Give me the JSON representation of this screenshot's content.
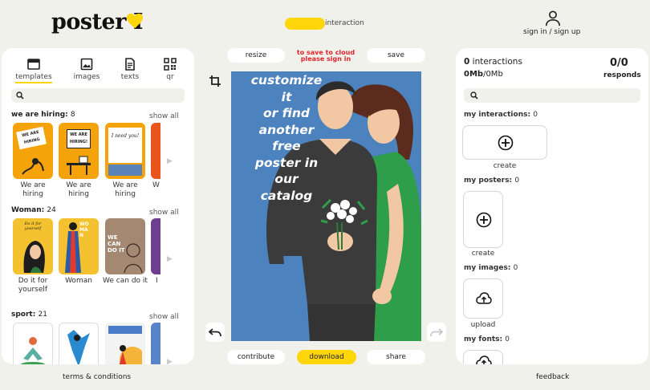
{
  "header": {
    "logo_text": "poster I",
    "interaction_label": "interaction",
    "signin_label": "sign in / sign up",
    "accent_color": "#ffd60a"
  },
  "left_panel": {
    "tabs": [
      {
        "label": "templates",
        "icon": "templates-icon",
        "active": true
      },
      {
        "label": "images",
        "icon": "image-icon",
        "active": false
      },
      {
        "label": "texts",
        "icon": "document-icon",
        "active": false
      },
      {
        "label": "qr",
        "icon": "qr-code-icon",
        "active": false
      }
    ],
    "show_all_label": "show all",
    "sections": [
      {
        "title": "we are hiring:",
        "count": "8",
        "items": [
          {
            "caption": "We are hiring",
            "thumb_text": "WE ARE HIRING"
          },
          {
            "caption": "We are hiring",
            "thumb_text": "WE ARE HIRING!"
          },
          {
            "caption": "We are hiring",
            "thumb_text": "I need you!"
          },
          {
            "caption": "W"
          }
        ]
      },
      {
        "title": "Woman:",
        "count": "24",
        "items": [
          {
            "caption": "Do it for yourself",
            "thumb_text": "Do it for yourself"
          },
          {
            "caption": "Woman",
            "thumb_text": "WOMAN"
          },
          {
            "caption": "We can do it",
            "thumb_text": "WE CAN DO IT"
          },
          {
            "caption": "I"
          }
        ]
      },
      {
        "title": "sport:",
        "count": "21",
        "items": [
          {
            "caption": ""
          },
          {
            "caption": ""
          },
          {
            "caption": ""
          },
          {
            "caption": ""
          }
        ]
      }
    ]
  },
  "center": {
    "resize_label": "resize",
    "save_label": "save",
    "save_warning_line1": "to save to cloud",
    "save_warning_line2": "please sign in",
    "poster_text_lines": [
      "customize",
      "it",
      "or find",
      "another",
      "free",
      "poster in",
      "our",
      "catalog"
    ],
    "contribute_label": "contribute",
    "download_label": "download",
    "share_label": "share"
  },
  "right_panel": {
    "interactions_count": "0",
    "interactions_label": "interactions",
    "storage_used": "0Mb",
    "storage_total": "/0Mb",
    "responds_value": "0/0",
    "responds_label": "responds",
    "my_interactions_label": "my interactions:",
    "my_interactions_count": "0",
    "create_label": "create",
    "my_posters_label": "my posters:",
    "my_posters_count": "0",
    "create_label_2": "create",
    "my_images_label": "my images:",
    "my_images_count": "0",
    "upload_label": "upload",
    "my_fonts_label": "my fonts:",
    "my_fonts_count": "0"
  },
  "footer": {
    "terms_label": "terms & conditions",
    "feedback_label": "feedback"
  }
}
